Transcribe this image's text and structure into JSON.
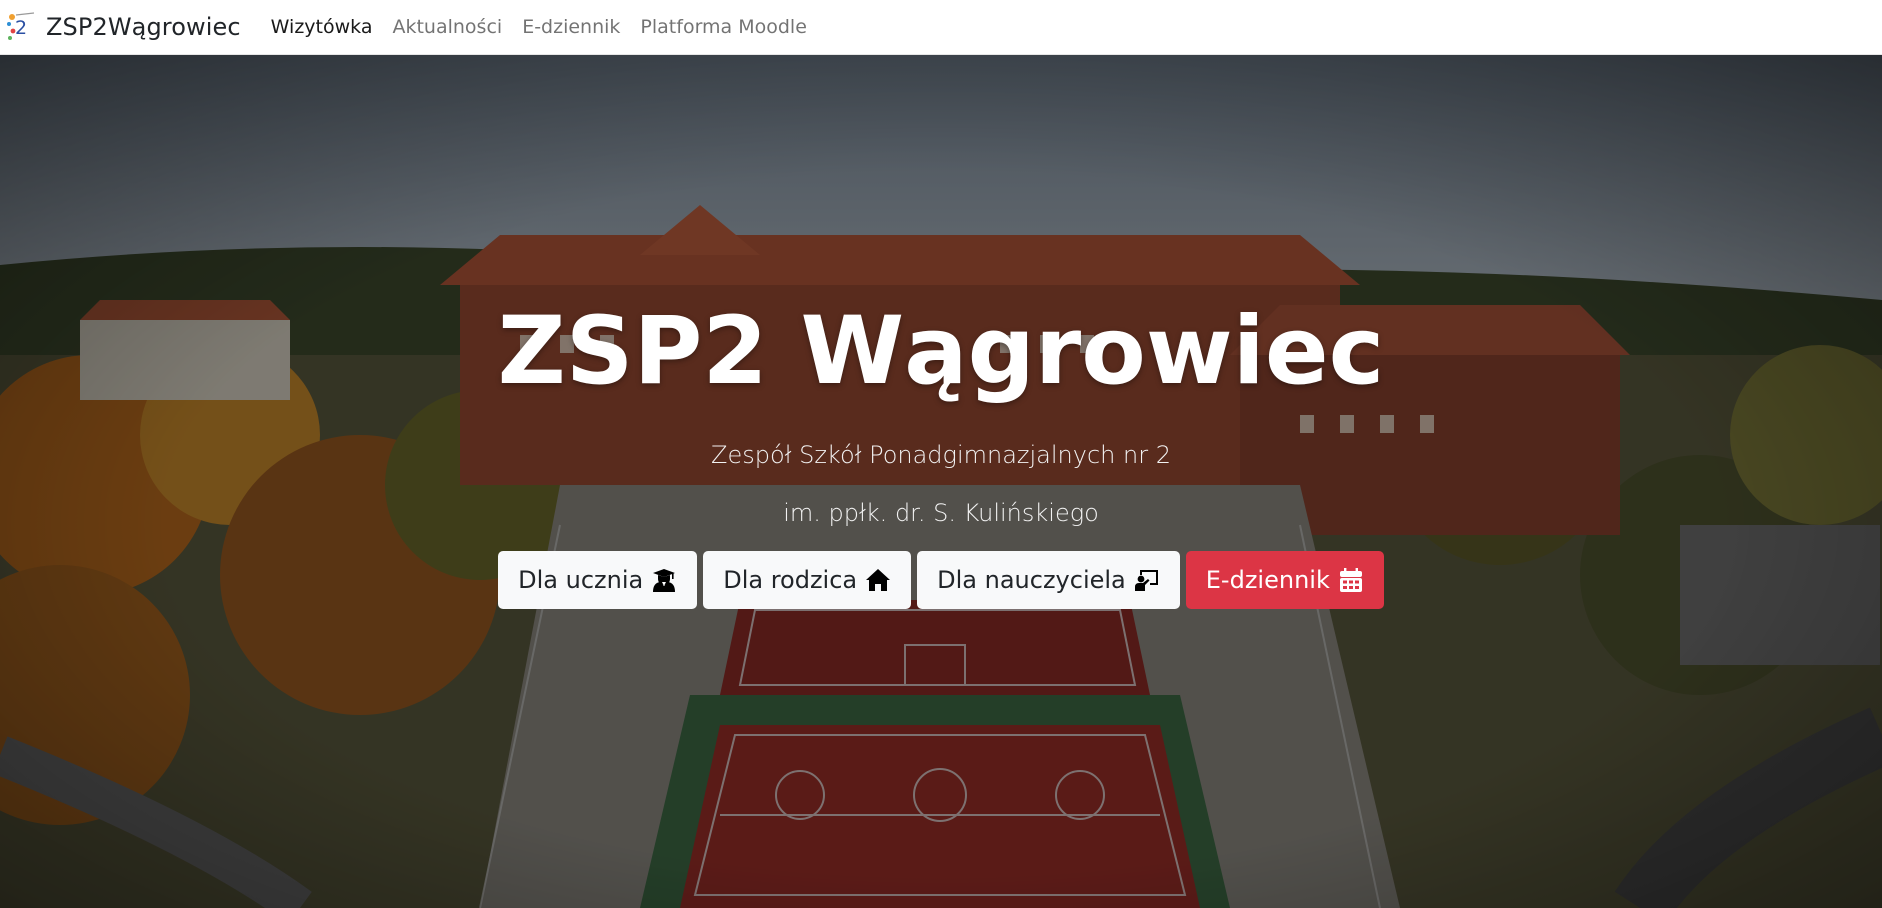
{
  "navbar": {
    "brand_text": "ZSP2Wągrowiec",
    "logo_icon": "school-logo-icon",
    "links": [
      {
        "label": "Wizytówka",
        "active": true
      },
      {
        "label": "Aktualności",
        "active": false
      },
      {
        "label": "E-dziennik",
        "active": false
      },
      {
        "label": "Platforma Moodle",
        "active": false
      }
    ]
  },
  "hero": {
    "title": "ZSP2 Wągrowiec",
    "subtitle_line1": "Zespół Szkół Ponadgimnazjalnych nr 2",
    "subtitle_line2": "im. ppłk. dr. S. Kulińskiego",
    "background_image": "aerial-school-campus-photo",
    "buttons": [
      {
        "label": "Dla ucznia",
        "icon": "user-graduate-icon",
        "style": "light"
      },
      {
        "label": "Dla rodzica",
        "icon": "home-icon",
        "style": "light"
      },
      {
        "label": "Dla nauczyciela",
        "icon": "chalkboard-teacher-icon",
        "style": "light"
      },
      {
        "label": "E-dziennik",
        "icon": "calendar-icon",
        "style": "danger"
      }
    ]
  },
  "colors": {
    "danger": "#dc3545",
    "light": "#f8f9fa",
    "text_dark": "#212529",
    "nav_muted": "#8c8c8c"
  }
}
